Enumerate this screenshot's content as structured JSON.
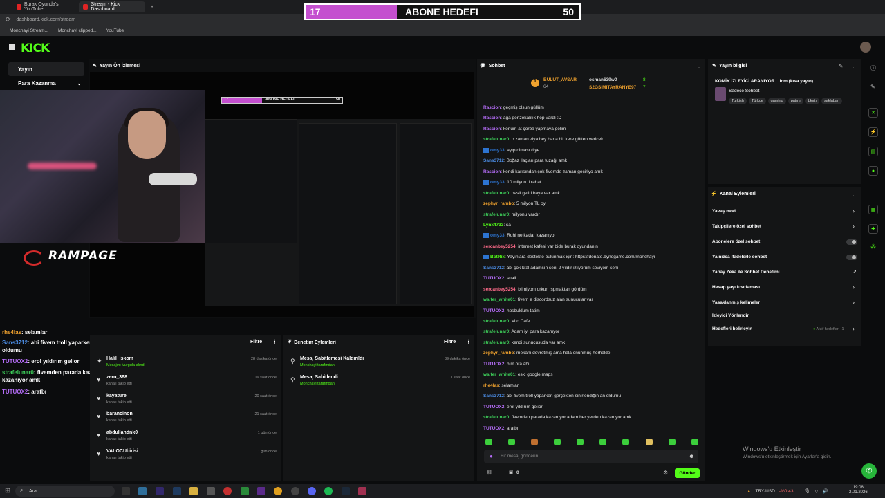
{
  "browser": {
    "tabs": [
      {
        "title": "Burak Oyunda's YouTube"
      },
      {
        "title": "Stream - Kick Dashboard"
      }
    ],
    "url": "dashboard.kick.com/stream",
    "bookmarks": [
      "Monchayi Stream...",
      "Monchayi clipped...",
      "YouTube"
    ]
  },
  "goal_banner": {
    "current": "17",
    "title": "ABONE HEDEFI",
    "target": "50",
    "fill_fraction": 0.34,
    "color": "#c44fcf"
  },
  "brand": {
    "logo": "KICK",
    "accent": "#53fc18"
  },
  "sidebar": {
    "items": [
      {
        "label": "Yayın"
      },
      {
        "label": "Para Kazanma"
      }
    ]
  },
  "preview": {
    "title": "Yayın Ön İzlemesi",
    "overlay_brand": "RAMPAGE",
    "mini_goal": {
      "current": "17",
      "title": "ABONE HEDEFI",
      "target": "50"
    }
  },
  "overlay_chat": [
    {
      "user": "rhe4las",
      "text": ": selamlar"
    },
    {
      "user": "Sans3712",
      "text": ": abi fivem troll yaparken gerçekten sinirlendiğin an oldumu"
    },
    {
      "user": "TUTUOX2",
      "text": ": erol yıldırım gelior"
    },
    {
      "user": "strafelunar0",
      "text": ": fivemden parada kazanıyor adam her yerden kazanıyor amk"
    },
    {
      "user": "TUTUOX2",
      "text": ": aratbı"
    }
  ],
  "activity": {
    "filter_label": "Filtre",
    "rows": [
      {
        "name": "Halil_iskom",
        "sub": "Mesajını Vurgula  alındı",
        "time": "28 dakika önce"
      },
      {
        "name": "zero_368",
        "sub": "kanalı takip etti",
        "time": "19 saat önce"
      },
      {
        "name": "kayature",
        "sub": "kanalı takip etti",
        "time": "20 saat önce"
      },
      {
        "name": "barancinon",
        "sub": "kanalı takip etti",
        "time": "21 saat önce"
      },
      {
        "name": "abdullahdnk0",
        "sub": "kanalı takip etti",
        "time": "1 gün önce"
      },
      {
        "name": "VALOCUbirisi",
        "sub": "kanalı takip etti",
        "time": "1 gün önce"
      }
    ]
  },
  "moderation": {
    "title": "Denetim Eylemleri",
    "filter_label": "Filtre",
    "rows": [
      {
        "name": "Mesaj Sabitlemesi Kaldırıldı",
        "sub": "Monchayi tarafından",
        "time": "39 dakika önce"
      },
      {
        "name": "Mesaj Sabitlendi",
        "sub": "Monchayi tarafından",
        "time": "1 saat önce"
      }
    ]
  },
  "chat": {
    "title": "Sohbet",
    "top_gifters": [
      {
        "name": "BULUT_AVSAR",
        "count": "64"
      },
      {
        "name": "osman639w0",
        "count": "8"
      },
      {
        "name": "S2GSIMITAYRANYE97",
        "count": "7"
      }
    ],
    "messages": [
      {
        "user": "Rascion",
        "color": "#b36cf5",
        "text": ": geçmiş olsun güllüm"
      },
      {
        "user": "Rascion",
        "color": "#b36cf5",
        "text": ": aga gerizekalılık hep vardı :D"
      },
      {
        "user": "Rascion",
        "color": "#b36cf5",
        "text": ": konum at çorba yapmaya gelim"
      },
      {
        "user": "strafelunar0",
        "color": "#3ecf5a",
        "text": ": o zaman ziya bey bana bir kere götten vericek"
      },
      {
        "user": "omy33",
        "color": "#2d74d1",
        "text": ": ayıp olması diye",
        "badge": true
      },
      {
        "user": "Sans3712",
        "color": "#4a8ae0",
        "text": ": Boğaz ilaçları para tuzağı amk"
      },
      {
        "user": "Rascion",
        "color": "#b36cf5",
        "text": ": kendi karısından çok fivemde zaman geçiriyo amk"
      },
      {
        "user": "omy33",
        "color": "#2d74d1",
        "text": ": 10 milyon tl rahat",
        "badge": true
      },
      {
        "user": "strafelunar0",
        "color": "#3ecf5a",
        "text": ": pasif geliri baya var amk"
      },
      {
        "user": "zephyr_rambo",
        "color": "#f0a22e",
        "text": ": 5 milyon TL oy"
      },
      {
        "user": "strafelunar0",
        "color": "#3ecf5a",
        "text": ": milyonu vardır"
      },
      {
        "user": "Lynx4733",
        "color": "#53fc18",
        "text": ": sa"
      },
      {
        "user": "omy33",
        "color": "#2d74d1",
        "text": ": Ruhi ne kadar kazanıyo",
        "badge": true
      },
      {
        "user": "sercanbey5254",
        "color": "#ff6b8a",
        "text": ": internet kafesi var bide burak oyundanın"
      },
      {
        "user": "BotRix",
        "color": "#53fc18",
        "text": ": Yayınlara destekte bulunmak için: https://donate.bynogame.com/monchayi",
        "badge": true
      },
      {
        "user": "Sans3712",
        "color": "#4a8ae0",
        "text": ": abi çok kral adamsın seni 2 yıldır izliyorum seviyom seni"
      },
      {
        "user": "TUTUOX2",
        "color": "#b36cf5",
        "text": ": suali"
      },
      {
        "user": "sercanbey5254",
        "color": "#ff6b8a",
        "text": ": bilmiyom orkun ıspmaktan gördüm"
      },
      {
        "user": "walter_white01",
        "color": "#3ecf5a",
        "text": ": fivem e discordsuz alan sunucular var"
      },
      {
        "user": "TUTUOX2",
        "color": "#b36cf5",
        "text": ": hosbuldum tatim"
      },
      {
        "user": "strafelunar0",
        "color": "#3ecf5a",
        "text": ": Vito Cafe"
      },
      {
        "user": "strafelunar0",
        "color": "#3ecf5a",
        "text": ": Adam iyi para kazanıyor"
      },
      {
        "user": "strafelunar0",
        "color": "#3ecf5a",
        "text": ": kendi sunucusuda var amk"
      },
      {
        "user": "zephyr_rambo",
        "color": "#f0a22e",
        "text": ": mekanı devretmiş ama hala onunmuş herhalde"
      },
      {
        "user": "TUTUOX2",
        "color": "#b36cf5",
        "text": ": bım ora abi"
      },
      {
        "user": "walter_white01",
        "color": "#3ecf5a",
        "text": ": eski google maps"
      },
      {
        "user": "rhe4las",
        "color": "#f0a22e",
        "text": ": selamlar"
      },
      {
        "user": "Sans3712",
        "color": "#4a8ae0",
        "text": ": abi fivem troll yaparken gerçekten sinirlendiğin an oldumu"
      },
      {
        "user": "TUTUOX2",
        "color": "#b36cf5",
        "text": ": erol yıldırım gelior"
      },
      {
        "user": "strafelunar0",
        "color": "#3ecf5a",
        "text": ": fivemden parada kazanıyor adam her yerden kazanıyor amk"
      },
      {
        "user": "TUTUOX2",
        "color": "#b36cf5",
        "text": ": aratbı"
      }
    ],
    "input_placeholder": "Bir mesaj gönderin",
    "count": "0",
    "send_label": "Gönder"
  },
  "stream_info": {
    "title": "Yayın bilgisi",
    "stream_title": "KOMİK İZLEYİCİ ARANIYOR... lcm (kısa yayın)",
    "category": "Sadece Sohbet",
    "tags": [
      "Turkish",
      "Türkçe",
      "gaming",
      "patırtı",
      "bkırtı",
      "şaklaban"
    ]
  },
  "channel_actions": {
    "title": "Kanal Eylemleri",
    "items": [
      {
        "label": "Yavaş mod",
        "control": "chevron"
      },
      {
        "label": "Takipçilere özel sohbet",
        "control": "chevron"
      },
      {
        "label": "Abonelere özel sohbet",
        "control": "toggle"
      },
      {
        "label": "Yalnızca ifadelerle sohbet",
        "control": "toggle"
      },
      {
        "label": "Yapay Zeka ile Sohbet Denetimi",
        "control": "external"
      },
      {
        "label": "Hesap yaşı kısıtlaması",
        "control": "chevron"
      },
      {
        "label": "Yasaklanmış kelimeler",
        "control": "chevron"
      },
      {
        "label": "İzleyici Yönlendir",
        "control": "none"
      },
      {
        "label": "Hedefleri belirleyin",
        "control": "chevron",
        "status": "Aktif hedefler - 1"
      }
    ]
  },
  "windows": {
    "activation_title": "Windows'u Etkinleştir",
    "activation_sub": "Windows'u etkinleştirmek için Ayarlar'a gidin.",
    "search": "Ara",
    "currency": "TRY/USD",
    "currency_change": "-%0,43",
    "time": "19:08",
    "date": "2.01.2026"
  }
}
